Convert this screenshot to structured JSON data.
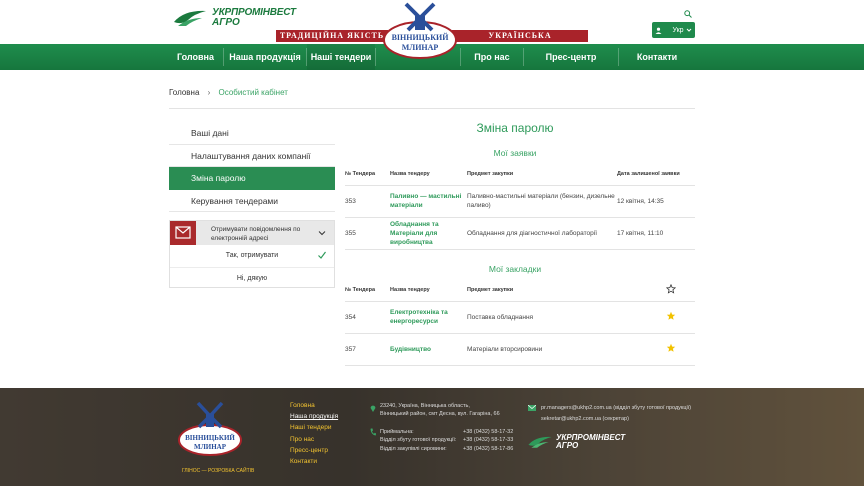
{
  "header": {
    "logo_line1": "УКРПРОМІНВЕСТ",
    "logo_line2": "АГРО",
    "ribbon_left": "ТРАДИЦІЙНА ЯКІСТЬ",
    "ribbon_right": "УКРАЇНСЬКА ГОСТИННІСТЬ",
    "brand_line1": "ВІННИЦЬКИЙ",
    "brand_line2": "МЛИНАР",
    "lang": "Укр",
    "accent": "#1f8a4c"
  },
  "nav": {
    "items": [
      {
        "label": "Головна"
      },
      {
        "label": "Наша продукція"
      },
      {
        "label": "Наші тендери"
      },
      {
        "label": "Про нас"
      },
      {
        "label": "Прес-центр"
      },
      {
        "label": "Контакти"
      }
    ]
  },
  "breadcrumb": {
    "home": "Головна",
    "separator": "›",
    "current": "Особистий кабінет"
  },
  "sidebar": {
    "items": [
      {
        "label": "Ваші дані"
      },
      {
        "label": "Налаштування даних компанії"
      },
      {
        "label": "Зміна паролю"
      },
      {
        "label": "Керування тендерами"
      }
    ],
    "notifications": {
      "label": "Отримувати повідомлення по електронній адресі",
      "options": [
        {
          "label": "Так, отримувати"
        },
        {
          "label": "Ні, дякую"
        }
      ]
    }
  },
  "main": {
    "title": "Зміна паролю",
    "applications": {
      "title": "Мої заявки",
      "headers": [
        "№ Тендера",
        "Назва тендеру",
        "Предмет закупки",
        "Дата залишеної заявки"
      ],
      "rows": [
        {
          "num": "353",
          "name": "Паливно — мастильні матеріали",
          "subject": "Паливно-мастильні матеріали (бензин, дизельне паливо)",
          "date": "12 квітня, 14:35"
        },
        {
          "num": "355",
          "name": "Обладнання та Матеріали для виробництва",
          "subject": "Обладнання для діагностичної лабораторії",
          "date": "17 квітня, 11:10"
        }
      ]
    },
    "bookmarks": {
      "title": "Мої закладки",
      "headers": [
        "№ Тендера",
        "Назва тендеру",
        "Предмет закупки"
      ],
      "rows": [
        {
          "num": "354",
          "name": "Електротехніка та енергоресурси",
          "subject": "Поставка обладнання"
        },
        {
          "num": "357",
          "name": "Будівництво",
          "subject": "Матеріали вторсировини"
        }
      ]
    }
  },
  "footer": {
    "links": [
      {
        "label": "Головна"
      },
      {
        "label": "Наша продукція"
      },
      {
        "label": "Наші тендери"
      },
      {
        "label": "Про нас"
      },
      {
        "label": "Пресс-центр"
      },
      {
        "label": "Контакти"
      }
    ],
    "address_line1": "23240, Україна, Вінницька область,",
    "address_line2": "Вінницький район, смт Десна, вул. Гагаріна, 66",
    "phones": [
      {
        "label": "Приймальна:",
        "number": "+38 (0432) 58-17-32"
      },
      {
        "label": "Відділ збуту готової продукції:",
        "number": "+38 (0432) 58-17-33"
      },
      {
        "label": "Відділ закупівлі сировини:",
        "number": "+38 (0432) 58-17-86"
      }
    ],
    "email1": "pr.managers@ukhp2.com.ua (відділ збуту готової продукції)",
    "email2": "sekretar@ukhp2.com.ua (секретар)",
    "credit": "ГЛІНОС — РОЗРОБКА САЙТІВ",
    "logo_line1": "УКРПРОМІНВЕСТ",
    "logo_line2": "АГРО"
  }
}
